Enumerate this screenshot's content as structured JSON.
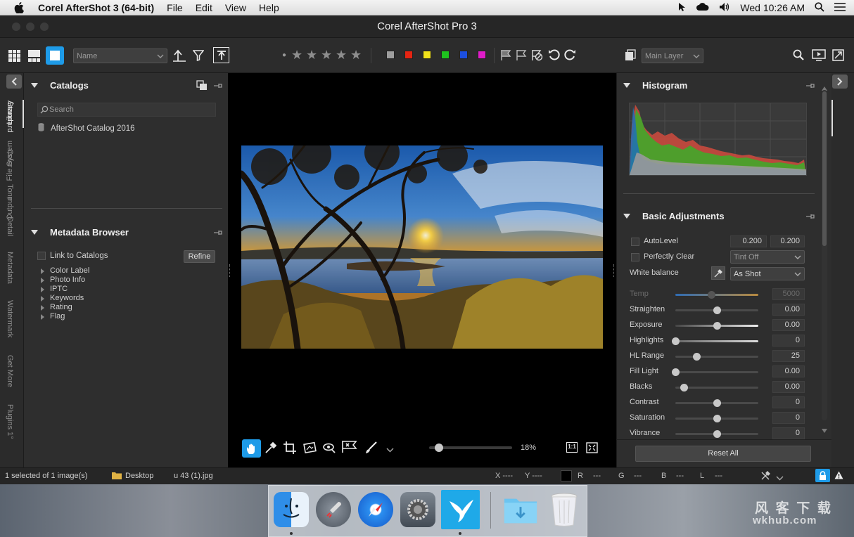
{
  "menubar": {
    "app_name": "Corel AfterShot 3 (64-bit)",
    "items": [
      "File",
      "Edit",
      "View",
      "Help"
    ],
    "clock": "Wed 10:26 AM"
  },
  "window": {
    "title": "Corel AfterShot Pro 3"
  },
  "toolbar": {
    "sort_select": "Name",
    "layer_select": "Main Layer",
    "color_labels": [
      "#9e9e9e",
      "#e62412",
      "#f2e21a",
      "#1ec21e",
      "#1c4fe0",
      "#e01cc9"
    ]
  },
  "left_tabs": [
    "Library",
    "File System",
    "Output"
  ],
  "catalogs": {
    "title": "Catalogs",
    "search_placeholder": "Search",
    "items": [
      "AfterShot Catalog 2016"
    ]
  },
  "metadata": {
    "title": "Metadata Browser",
    "link_label": "Link to Catalogs",
    "refine_button": "Refine",
    "items": [
      "Color Label",
      "Photo Info",
      "IPTC",
      "Keywords",
      "Rating",
      "Flag"
    ]
  },
  "viewer": {
    "zoom": "18%",
    "zoom_level": 0.12,
    "one_to_one": "1:1"
  },
  "right_tabs": [
    "Standard",
    "Color",
    "Tone",
    "Detail",
    "Metadata",
    "Watermark",
    "Get More",
    "Plugins 1°"
  ],
  "histogram": {
    "title": "Histogram"
  },
  "basic": {
    "title": "Basic Adjustments",
    "autolevel": {
      "label": "AutoLevel",
      "v1": "0.200",
      "v2": "0.200"
    },
    "perfectly_clear": {
      "label": "Perfectly Clear",
      "option": "Tint Off"
    },
    "white_balance": {
      "label": "White balance",
      "option": "As Shot"
    },
    "sliders": [
      {
        "label": "Temp",
        "value": "5000",
        "pos": 0.43,
        "disabled": true
      },
      {
        "label": "Straighten",
        "value": "0.00",
        "pos": 0.5
      },
      {
        "label": "Exposure",
        "value": "0.00",
        "pos": 0.5
      },
      {
        "label": "Highlights",
        "value": "0",
        "pos": 0.0
      },
      {
        "label": "HL Range",
        "value": "25",
        "pos": 0.25
      },
      {
        "label": "Fill Light",
        "value": "0.00",
        "pos": 0.0
      },
      {
        "label": "Blacks",
        "value": "0.00",
        "pos": 0.1
      },
      {
        "label": "Contrast",
        "value": "0",
        "pos": 0.5
      },
      {
        "label": "Saturation",
        "value": "0",
        "pos": 0.5
      },
      {
        "label": "Vibrance",
        "value": "0",
        "pos": 0.5
      }
    ],
    "reset_button": "Reset All"
  },
  "status": {
    "selection": "1 selected of 1 image(s)",
    "folder": "Desktop",
    "filename": "u 43 (1).jpg",
    "x": "X ----",
    "y": "Y ----",
    "r_label": "R",
    "r": "---",
    "g_label": "G",
    "g": "---",
    "b_label": "B",
    "b": "---",
    "l_label": "L",
    "l": "---"
  },
  "watermark": {
    "line1": "风 客 下 载",
    "line2": "wkhub.com"
  }
}
